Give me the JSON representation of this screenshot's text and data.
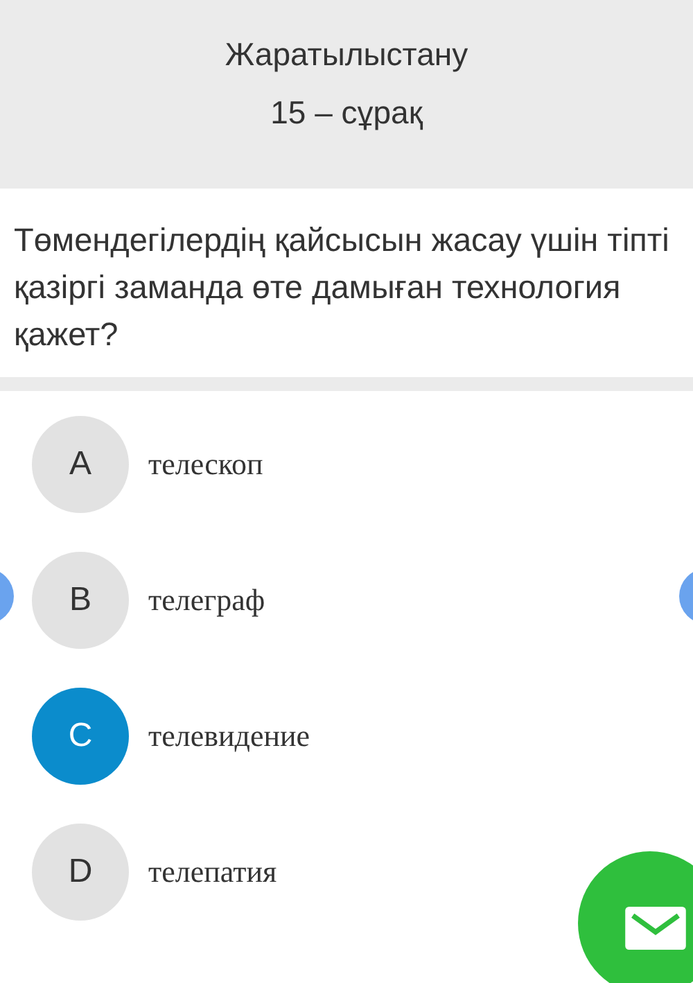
{
  "header": {
    "subject": "Жаратылыстану",
    "question_number": "15 – сұрақ"
  },
  "question": "Төмендегілердің қайсысын жасау үшін тіпті қазіргі заманда өте дамыған технология қажет?",
  "options": [
    {
      "letter": "A",
      "text": "телескоп",
      "selected": false
    },
    {
      "letter": "B",
      "text": "телеграф",
      "selected": false
    },
    {
      "letter": "C",
      "text": "телевидение",
      "selected": true
    },
    {
      "letter": "D",
      "text": "телепатия",
      "selected": false
    }
  ]
}
